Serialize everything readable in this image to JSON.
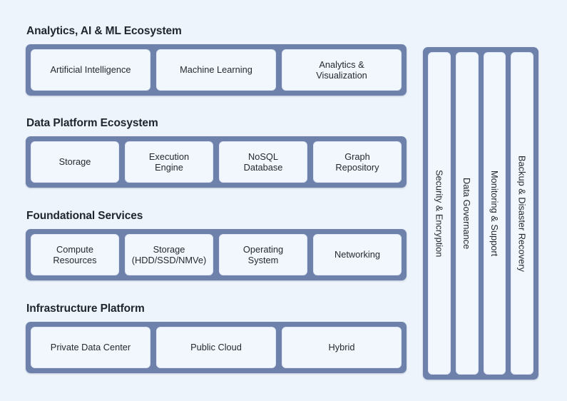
{
  "canvas": {
    "background_color": "#eef4fb",
    "frame_color": "#6d81ab",
    "cell_color": "#f2f7fd",
    "text_color": "#24292f",
    "title_color": "#20262f"
  },
  "layers": [
    {
      "title": "Analytics, AI & ML Ecosystem",
      "cells": [
        "Artificial Intelligence",
        "Machine Learning",
        "Analytics &\nVisualization"
      ]
    },
    {
      "title": "Data Platform Ecosystem",
      "cells": [
        "Storage",
        "Execution\nEngine",
        "NoSQL\nDatabase",
        "Graph\nRepository"
      ]
    },
    {
      "title": "Foundational Services",
      "cells": [
        "Compute\nResources",
        "Storage\n(HDD/SSD/NMVe)",
        "Operating\nSystem",
        "Networking"
      ]
    },
    {
      "title": "Infrastructure Platform",
      "cells": [
        "Private Data Center",
        "Public Cloud",
        "Hybrid"
      ]
    }
  ],
  "cross_cutting": {
    "cells": [
      "Security & Encryption",
      "Data Governance",
      "Monitoring & Support",
      "Backup & Disaster Recovery"
    ]
  }
}
